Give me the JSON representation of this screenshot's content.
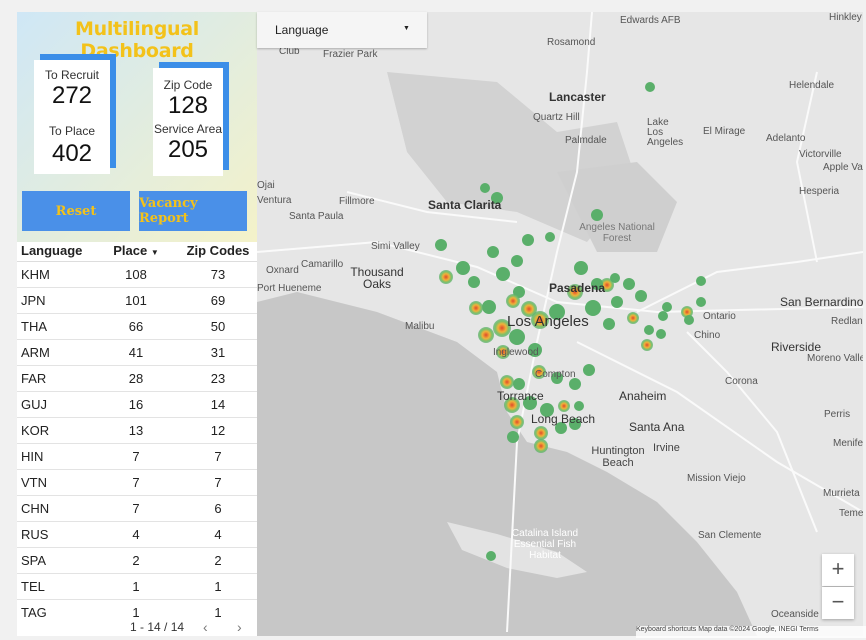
{
  "dashboard": {
    "title": "Multilingual Dashboard",
    "recruit_label": "To Recruit",
    "recruit_value": "272",
    "place_label": "To Place",
    "place_value": "402",
    "zip_label": "Zip Code",
    "zip_value": "128",
    "service_label": "Service Area",
    "service_value": "205",
    "reset_label": "Reset",
    "vacancy_label": "Vacancy Report",
    "accent": "#4a90e8",
    "title_color": "#f3c21a"
  },
  "table": {
    "headers": [
      "Language",
      "Place",
      "Zip Codes"
    ],
    "sort_icon": "caret-down-icon",
    "rows": [
      [
        "KHM",
        "108",
        "73"
      ],
      [
        "JPN",
        "101",
        "69"
      ],
      [
        "THA",
        "66",
        "50"
      ],
      [
        "ARM",
        "41",
        "31"
      ],
      [
        "FAR",
        "28",
        "23"
      ],
      [
        "GUJ",
        "16",
        "14"
      ],
      [
        "KOR",
        "13",
        "12"
      ],
      [
        "HIN",
        "7",
        "7"
      ],
      [
        "VTN",
        "7",
        "7"
      ],
      [
        "CHN",
        "7",
        "6"
      ],
      [
        "RUS",
        "4",
        "4"
      ],
      [
        "SPA",
        "2",
        "2"
      ],
      [
        "TEL",
        "1",
        "1"
      ],
      [
        "TAG",
        "1",
        "1"
      ]
    ],
    "pager": "1 - 14 / 14",
    "prev_icon": "chevron-left-icon",
    "next_icon": "chevron-right-icon"
  },
  "filter": {
    "label": "Language",
    "icon": "caret-down-icon"
  },
  "map": {
    "labels": [
      "Edwards AFB",
      "Hinkley",
      "Rosamond",
      "Frazier Park",
      "Lancaster",
      "Helendale",
      "Quartz Hill",
      "Palmdale",
      "Lake Los Angeles",
      "El Mirage",
      "Adelanto",
      "Victorville",
      "Apple Val",
      "Hesperia",
      "Santa Clarita",
      "Fillmore",
      "Santa Paula",
      "Angeles National Forest",
      "Simi Valley",
      "Oxnard",
      "Camarillo",
      "Thousand Oaks",
      "Port Hueneme",
      "Pasadena",
      "San Bernardino",
      "Los Angeles",
      "Malibu",
      "Ontario",
      "Redland",
      "Chino",
      "Riverside",
      "Moreno Valle",
      "Inglewood",
      "Compton",
      "Corona",
      "Torrance",
      "Anaheim",
      "Long Beach",
      "Santa Ana",
      "Perris",
      "Huntington Beach",
      "Irvine",
      "Menife",
      "Mission Viejo",
      "Murrieta",
      "Teme",
      "Catalina Island Essential Fish Habitat",
      "San Clemente",
      "Oceanside",
      "Club",
      "Ojai",
      "Ventura"
    ],
    "zoom_in": "+",
    "zoom_out": "−",
    "attribution": "Keyboard shortcuts   Map data ©2024 Google, INEGI   Terms"
  }
}
